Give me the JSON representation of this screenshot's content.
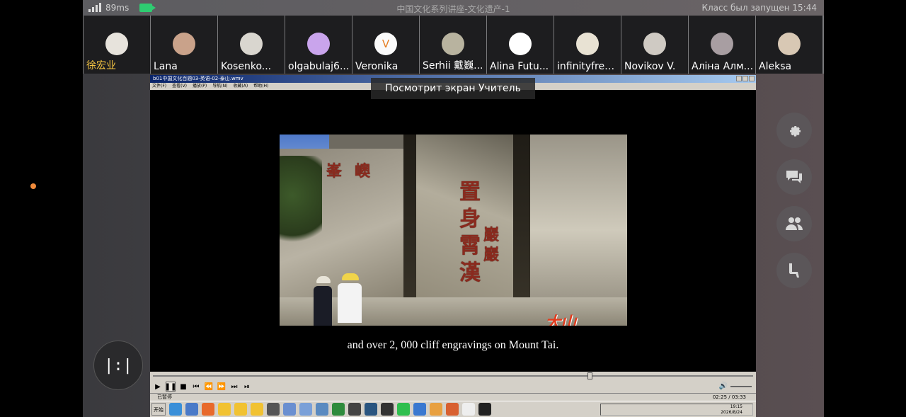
{
  "topbar": {
    "ping": "89ms",
    "title": "中国文化系列讲座-文化遗产-1",
    "status": "Класс был запущен",
    "time": "15:44"
  },
  "participants": [
    {
      "name": "徐宏业",
      "avatar_letter": "",
      "avatar_color": "#e7e3dc"
    },
    {
      "name": "Lana",
      "avatar_letter": "",
      "avatar_color": "#c9a28a"
    },
    {
      "name": "Kosenko...",
      "avatar_letter": "",
      "avatar_color": "#d9d6cf"
    },
    {
      "name": "olgabulaj6...",
      "avatar_letter": "",
      "avatar_color": "#c9a4ec"
    },
    {
      "name": "Veronika",
      "avatar_letter": "V",
      "avatar_color": "#fafafa"
    },
    {
      "name": "Serhii 戴巍...",
      "avatar_letter": "",
      "avatar_color": "#b8b39f"
    },
    {
      "name": "Alina Futu...",
      "avatar_letter": "",
      "avatar_color": "#ffffff"
    },
    {
      "name": "infinityfreq...",
      "avatar_letter": "",
      "avatar_color": "#e8e2d3"
    },
    {
      "name": "Novikov V.",
      "avatar_letter": "",
      "avatar_color": "#cfcac3"
    },
    {
      "name": "Аліна Алм...",
      "avatar_letter": "",
      "avatar_color": "#a89ea2"
    },
    {
      "name": "Aleksa",
      "avatar_letter": "",
      "avatar_color": "#d8c8b4"
    }
  ],
  "screen_share": {
    "viewer_label": "Посмотрит экран Учитель",
    "window_title": "b01中国文化百题03-英语-02-泰山.wmv",
    "menu": [
      "文件(F)",
      "查看(V)",
      "播放(P)",
      "导航(N)",
      "收藏(A)",
      "帮助(H)"
    ],
    "subtitle": "and over 2, 000 cliff engravings on Mount Tai.",
    "engravings": [
      "置",
      "身",
      "霄",
      "漢",
      "巖",
      "巖",
      "峯",
      "㠗"
    ],
    "watermark": "大山",
    "progress": 0.73,
    "status_text": "已暂停",
    "time_display": "02:25 / 03:33",
    "start_label": "开始",
    "clock": "19:15",
    "date": "2026/8/24"
  },
  "colors": {
    "accent": "#e67e22",
    "cam": "#2ecc71",
    "name_self": "#f5c542"
  },
  "sidebar_icons": [
    "gear-icon",
    "chat-icon",
    "users-icon",
    "seat-icon"
  ],
  "layout_button_label": "|:|"
}
